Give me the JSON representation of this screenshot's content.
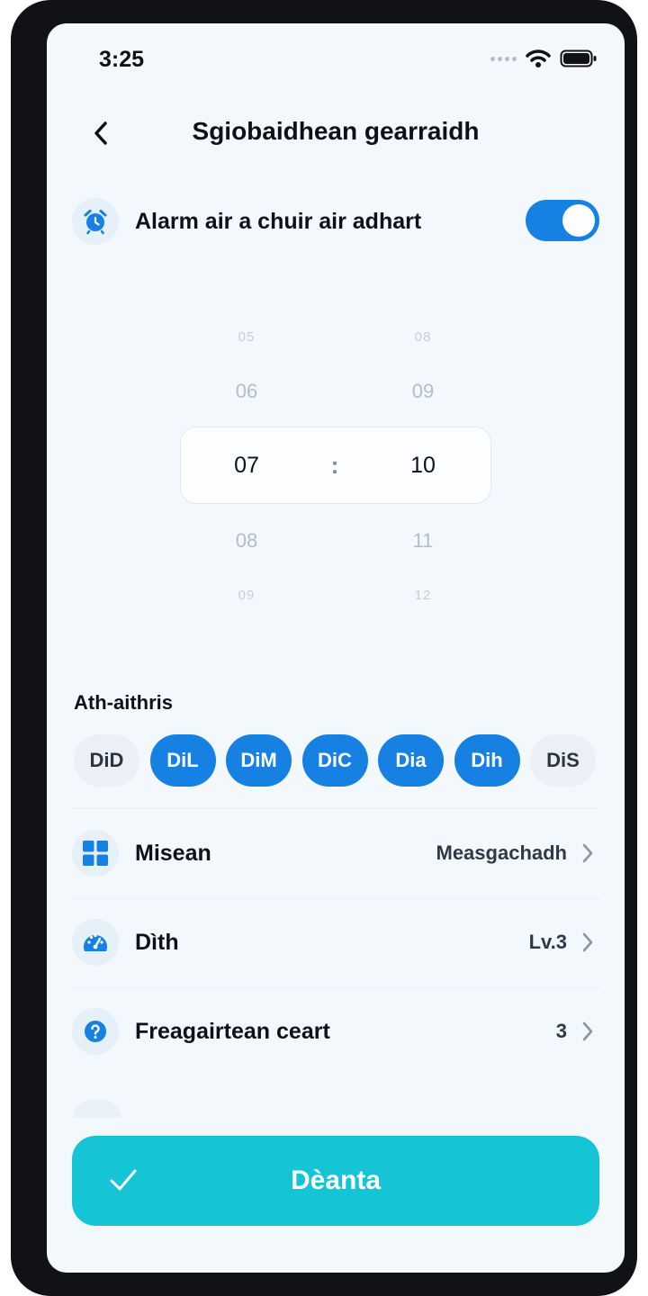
{
  "status": {
    "time": "3:25"
  },
  "header": {
    "title": "Sgiobaidhean gearraidh"
  },
  "alarm": {
    "label": "Alarm air a chuir air adhart",
    "enabled": true
  },
  "picker": {
    "hours": [
      "05",
      "06",
      "07",
      "08",
      "09"
    ],
    "minutes": [
      "08",
      "09",
      "10",
      "11",
      "12"
    ],
    "selected_hour": "07",
    "selected_minute": "10",
    "separator": ":"
  },
  "repeat": {
    "label": "Ath-aithris",
    "days": [
      {
        "label": "DiD",
        "active": false
      },
      {
        "label": "DiL",
        "active": true
      },
      {
        "label": "DiM",
        "active": true
      },
      {
        "label": "DiC",
        "active": true
      },
      {
        "label": "Dia",
        "active": true
      },
      {
        "label": "Dih",
        "active": true
      },
      {
        "label": "DiS",
        "active": false
      }
    ]
  },
  "settings": {
    "mission": {
      "label": "Misean",
      "value": "Measgachadh"
    },
    "difficulty": {
      "label": "Dìth",
      "value": "Lv.3"
    },
    "answers": {
      "label": "Freagairtean ceart",
      "value": "3"
    }
  },
  "done": {
    "label": "Dèanta"
  },
  "colors": {
    "accent": "#1681e3",
    "done": "#15c5d6",
    "background": "#f3f8fc"
  }
}
